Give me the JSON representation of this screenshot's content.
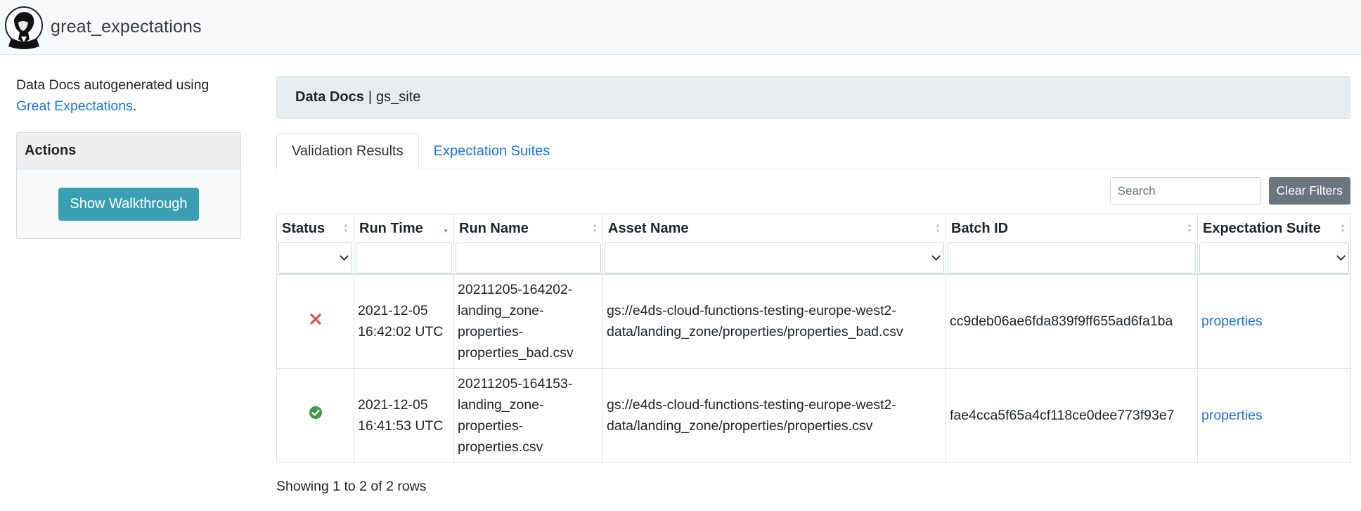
{
  "navbar": {
    "brand": "great_expectations",
    "logo_icon": "ge-logo-icon"
  },
  "sidebar": {
    "intro_text": "Data Docs autogenerated using ",
    "intro_link": "Great Expectations",
    "intro_period": ".",
    "actions_title": "Actions",
    "walkthrough_button": "Show Walkthrough"
  },
  "breadcrumb": {
    "title": "Data Docs",
    "separator": "|",
    "site": "gs_site"
  },
  "tabs": [
    {
      "label": "Validation Results",
      "active": true
    },
    {
      "label": "Expectation Suites",
      "active": false
    }
  ],
  "toolbar": {
    "search_placeholder": "Search",
    "clear_label": "Clear Filters"
  },
  "table": {
    "columns": [
      "Status",
      "Run Time",
      "Run Name",
      "Asset Name",
      "Batch ID",
      "Expectation Suite"
    ],
    "rows": [
      {
        "status": "failed",
        "status_icon": "x-icon",
        "run_time_1": "2021-12-05",
        "run_time_2": "16:42:02 UTC",
        "run_name": [
          "20211205-164202-",
          "landing_zone-",
          "properties-",
          "properties_bad.csv"
        ],
        "asset_name": [
          "gs://e4ds-cloud-functions-testing-europe-west2-",
          "data/landing_zone/properties/properties_bad.csv"
        ],
        "batch_id": "cc9deb06ae6fda839f9ff655ad6fa1ba",
        "suite": "properties"
      },
      {
        "status": "success",
        "status_icon": "check-circle-icon",
        "run_time_1": "2021-12-05",
        "run_time_2": "16:41:53 UTC",
        "run_name": [
          "20211205-164153-",
          "landing_zone-",
          "properties-",
          "properties.csv"
        ],
        "asset_name": [
          "gs://e4ds-cloud-functions-testing-europe-west2-",
          "data/landing_zone/properties/properties.csv"
        ],
        "batch_id": "fae4cca5f65a4cf118ce0dee773f93e7",
        "suite": "properties"
      }
    ]
  },
  "pagination": {
    "summary": "Showing 1 to 2 of 2 rows"
  },
  "colors": {
    "link": "#1a73e8",
    "fail": "#d9534f",
    "success": "#3c9a48",
    "walkthrough_button": "#3a9fb3",
    "clear_button": "#6c757d"
  }
}
